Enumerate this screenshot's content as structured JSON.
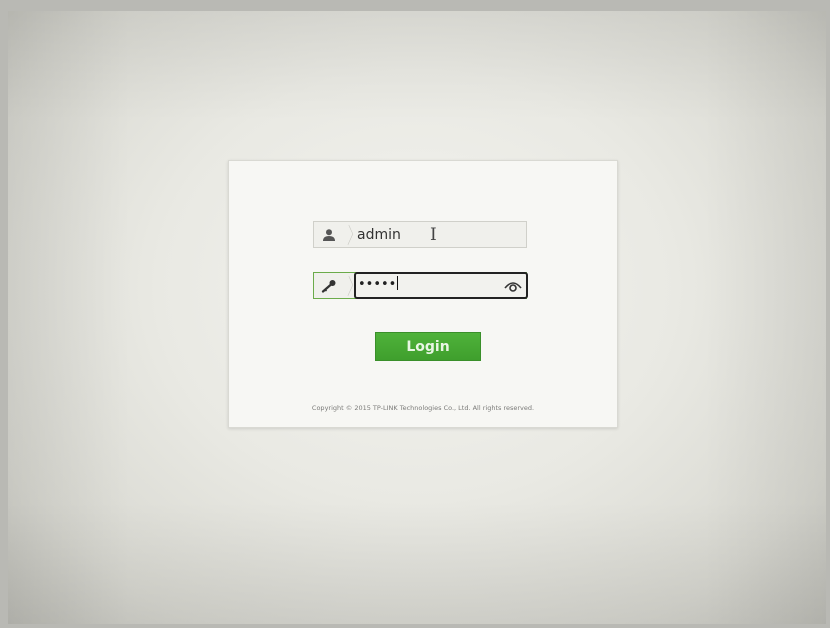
{
  "login": {
    "username_value": "admin",
    "password_mask": "•••••",
    "button_label": "Login",
    "copyright": "Copyright © 2015 TP-LINK Technologies Co., Ltd. All rights reserved."
  },
  "icons": {
    "username": "user-icon",
    "password": "key-icon",
    "show_password": "eye-icon",
    "cursor": "text-cursor-icon"
  },
  "colors": {
    "button": "#46a934",
    "focus_border": "#6bab4a"
  }
}
